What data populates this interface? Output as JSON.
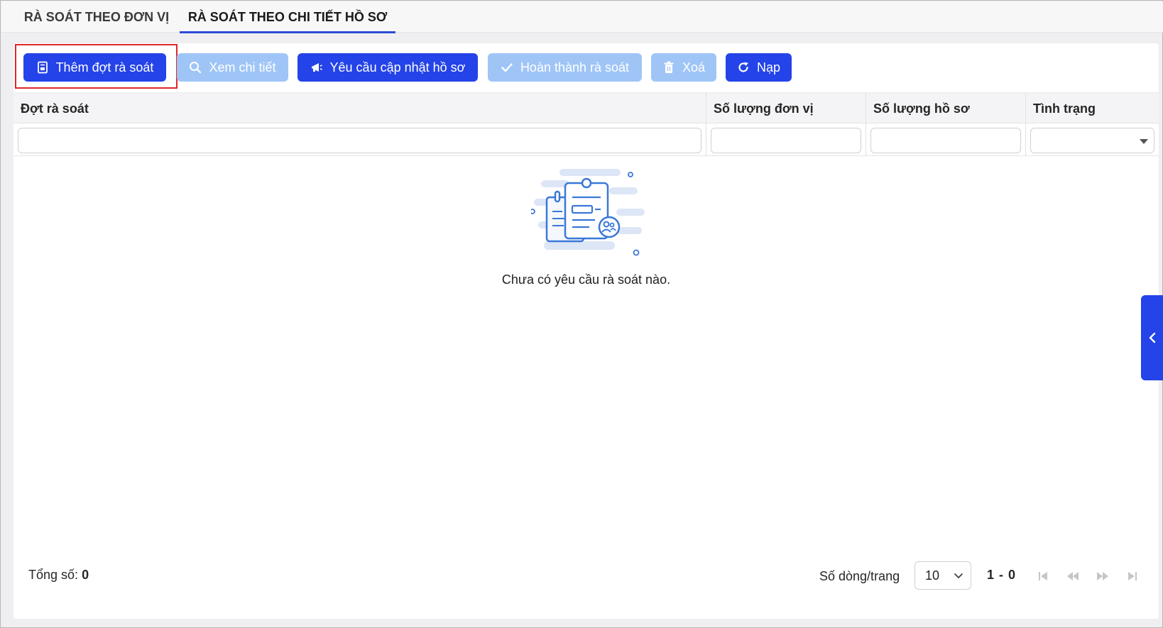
{
  "tabs": [
    {
      "label": "RÀ SOÁT THEO ĐƠN VỊ",
      "active": false
    },
    {
      "label": "RÀ SOÁT THEO CHI TIẾT HỒ SƠ",
      "active": true
    }
  ],
  "toolbar": {
    "add_label": "Thêm đợt rà soát",
    "view_label": "Xem chi tiết",
    "request_label": "Yêu cầu cập nhật hồ sơ",
    "complete_label": "Hoàn thành rà soát",
    "delete_label": "Xoá",
    "reload_label": "Nạp",
    "add_icon": "document-icon",
    "view_icon": "search-icon",
    "request_icon": "megaphone-icon",
    "complete_icon": "check-icon",
    "delete_icon": "trash-icon",
    "reload_icon": "refresh-icon"
  },
  "table": {
    "columns": [
      "Đợt rà soát",
      "Số lượng đơn vị",
      "Số lượng hồ sơ",
      "Tình trạng"
    ],
    "filters": {
      "col1": "",
      "col2": "",
      "col3": "",
      "col4": ""
    }
  },
  "empty_state": {
    "message": "Chưa có yêu cầu rà soát nào.",
    "icon": "empty-documents-illustration"
  },
  "footer": {
    "total_label": "Tổng số:",
    "total_value": "0",
    "rows_per_page_label": "Số dòng/trang",
    "rows_per_page_value": "10",
    "range": "1 - 0"
  },
  "colors": {
    "primary": "#2443e8",
    "disabled": "#9fc5f7",
    "highlight": "#e0272b",
    "tab_underline": "#2d4bd6"
  }
}
